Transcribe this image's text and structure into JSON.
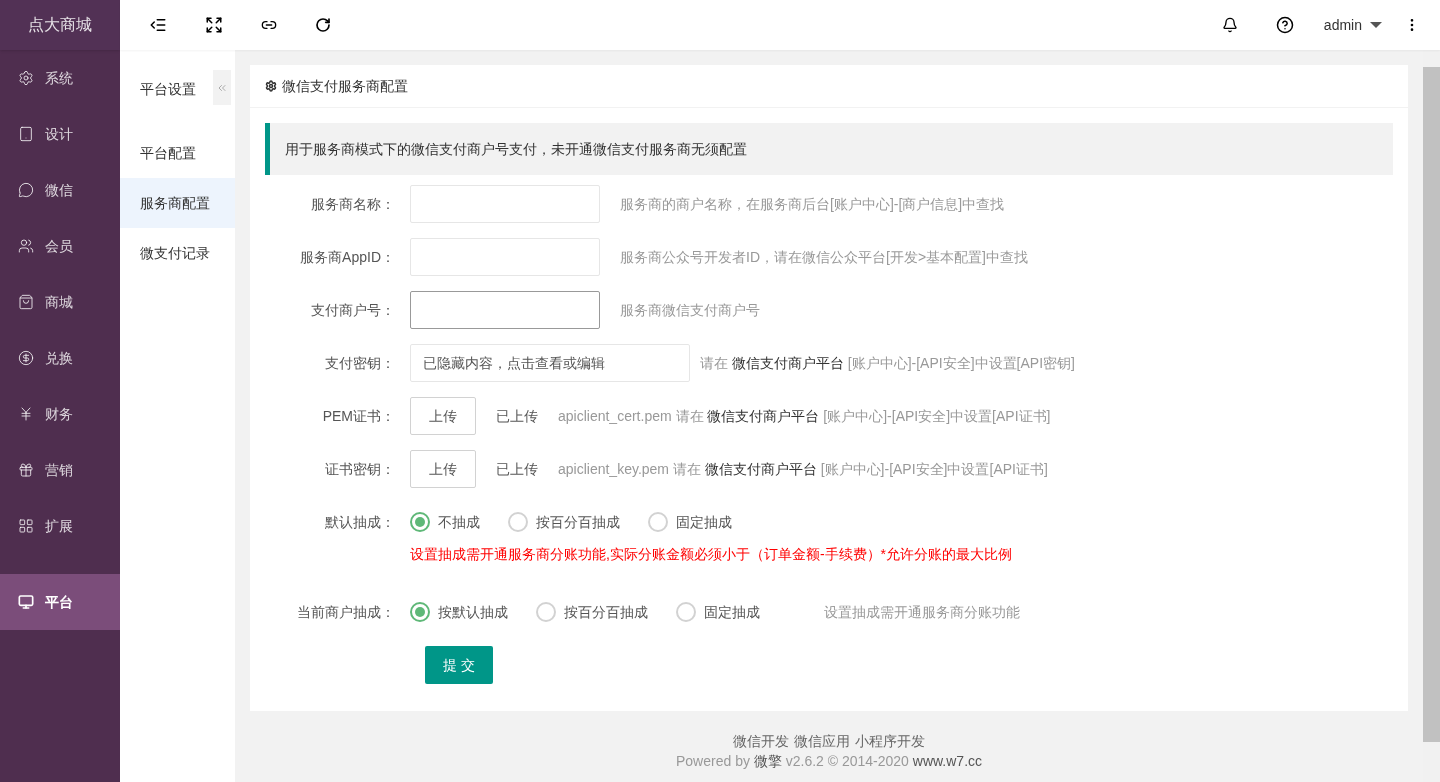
{
  "brand": "点大商城",
  "sidebar": {
    "items": [
      {
        "label": "系统",
        "selected": false
      },
      {
        "label": "设计",
        "selected": false
      },
      {
        "label": "微信",
        "selected": false
      },
      {
        "label": "会员",
        "selected": false
      },
      {
        "label": "商城",
        "selected": false
      },
      {
        "label": "兑换",
        "selected": false
      },
      {
        "label": "财务",
        "selected": false
      },
      {
        "label": "营销",
        "selected": false
      },
      {
        "label": "扩展",
        "selected": false
      },
      {
        "label": "平台",
        "selected": true
      }
    ]
  },
  "topbar": {
    "user": "admin"
  },
  "subnav": {
    "title": "平台设置",
    "items": [
      {
        "label": "平台配置",
        "selected": false
      },
      {
        "label": "服务商配置",
        "selected": true
      },
      {
        "label": "微支付记录",
        "selected": false
      }
    ]
  },
  "card": {
    "title": "微信支付服务商配置",
    "notice": "用于服务商模式下的微信支付商户号支付，未开通微信支付服务商无须配置",
    "rows": [
      {
        "kind": "input",
        "label": "服务商名称：",
        "focused": false,
        "hint": {
          "prefix": "服务商的商户名称，在服务商后台[账户中心]-[商户信息]中查找"
        }
      },
      {
        "kind": "input",
        "label": "服务商AppID：",
        "focused": false,
        "hint": {
          "prefix": "服务商公众号开发者ID，请在微信公众平台[开发>基本配置]中查找"
        }
      },
      {
        "kind": "input",
        "label": "支付商户号：",
        "focused": true,
        "hint": {
          "prefix": "服务商微信支付商户号"
        }
      },
      {
        "kind": "secret",
        "label": "支付密钥：",
        "value": "已隐藏内容，点击查看或编辑",
        "hint": {
          "prefix": "请在 ",
          "link": "微信支付商户平台",
          "suffix": " [账户中心]-[API安全]中设置[API密钥]"
        }
      },
      {
        "kind": "upload",
        "label": "PEM证书：",
        "button": "上传",
        "status": "已上传",
        "hint": {
          "prefix": "apiclient_cert.pem 请在 ",
          "link": "微信支付商户平台",
          "suffix": " [账户中心]-[API安全]中设置[API证书]"
        }
      },
      {
        "kind": "upload",
        "label": "证书密钥：",
        "button": "上传",
        "status": "已上传",
        "hint": {
          "prefix": "apiclient_key.pem 请在 ",
          "link": "微信支付商户平台",
          "suffix": " [账户中心]-[API安全]中设置[API证书]"
        }
      },
      {
        "kind": "radio",
        "label": "默认抽成：",
        "options": [
          {
            "label": "不抽成",
            "selected": true
          },
          {
            "label": "按百分百抽成",
            "selected": false
          },
          {
            "label": "固定抽成",
            "selected": false
          }
        ],
        "warning": "设置抽成需开通服务商分账功能,实际分账金额必须小于（订单金额-手续费）*允许分账的最大比例"
      },
      {
        "kind": "radio",
        "label": "当前商户抽成：",
        "options": [
          {
            "label": "按默认抽成",
            "selected": true
          },
          {
            "label": "按百分百抽成",
            "selected": false
          },
          {
            "label": "固定抽成",
            "selected": false
          }
        ],
        "note": "设置抽成需开通服务商分账功能"
      }
    ],
    "submit": "提 交"
  },
  "footer": {
    "links": [
      "微信开发",
      "微信应用",
      "小程序开发"
    ],
    "powered": {
      "prefix": "Powered by ",
      "brand": "微擎",
      "version": " v2.6.2 © 2014-2020 ",
      "site": "www.w7.cc"
    }
  }
}
